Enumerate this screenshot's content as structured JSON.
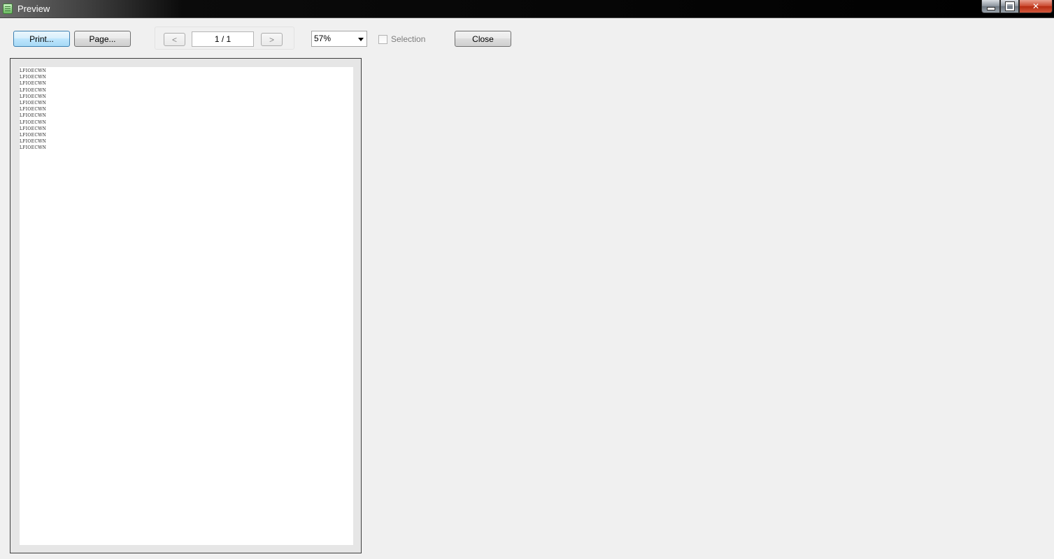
{
  "window": {
    "title": "Preview",
    "icon": "notepad-icon",
    "controls": {
      "minimize_icon": "minimize-icon",
      "maximize_icon": "restore-icon",
      "close_glyph": "✕"
    }
  },
  "toolbar": {
    "print_label": "Print...",
    "page_label": "Page...",
    "prev_label": "<",
    "page_indicator": "1 / 1",
    "next_label": ">",
    "zoom_value": "57%",
    "selection_label": "Selection",
    "selection_checked": false,
    "close_label": "Close"
  },
  "preview": {
    "lines": [
      "LFIOECWN",
      "LFIOECWN",
      "LFIOECWN",
      "LFIOECWN",
      "LFIOECWN",
      "LFIOECWN",
      "LFIOECWN",
      "LFIOECWN",
      "LFIOECWN",
      "LFIOECWN",
      "LFIOECWN",
      "LFIOECWN",
      "LFIOECWN"
    ]
  },
  "colors": {
    "focus_border": "#3c7fb1",
    "window_background": "#f0f0f0",
    "close_button": "#c9462c"
  }
}
